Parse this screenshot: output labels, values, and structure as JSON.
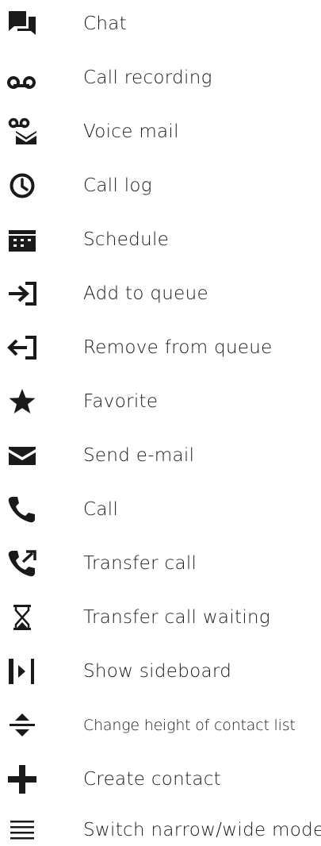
{
  "legend": {
    "items": [
      {
        "icon": "chat-icon",
        "label": "Chat"
      },
      {
        "icon": "call-recording-icon",
        "label": "Call recording"
      },
      {
        "icon": "voice-mail-icon",
        "label": "Voice mail"
      },
      {
        "icon": "clock-icon",
        "label": "Call log"
      },
      {
        "icon": "calendar-icon",
        "label": "Schedule"
      },
      {
        "icon": "add-to-queue-icon",
        "label": "Add to queue"
      },
      {
        "icon": "remove-from-queue-icon",
        "label": "Remove from queue"
      },
      {
        "icon": "star-icon",
        "label": "Favorite"
      },
      {
        "icon": "envelope-icon",
        "label": "Send e-mail"
      },
      {
        "icon": "phone-icon",
        "label": "Call"
      },
      {
        "icon": "transfer-call-icon",
        "label": "Transfer call"
      },
      {
        "icon": "hourglass-icon",
        "label": "Transfer call waiting"
      },
      {
        "icon": "sideboard-icon",
        "label": "Show sideboard"
      },
      {
        "icon": "resize-vertical-icon",
        "label": "Change height of contact list"
      },
      {
        "icon": "plus-icon",
        "label": "Create contact"
      },
      {
        "icon": "menu-lines-icon",
        "label": "Switch narrow/wide mode"
      }
    ]
  },
  "colors": {
    "icon": "#1a1a1a",
    "text": "#1a1a1a",
    "background": "#ffffff"
  }
}
